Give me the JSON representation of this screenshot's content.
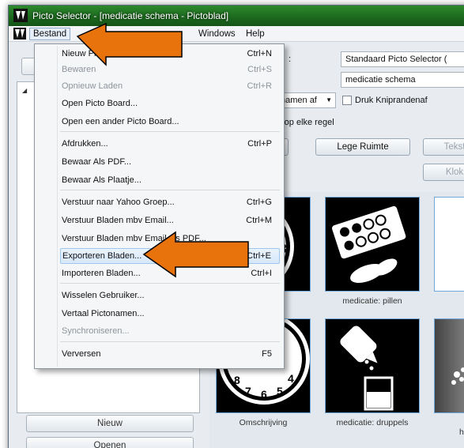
{
  "window": {
    "title": "Picto Selector - [medicatie schema - Pictoblad]"
  },
  "menubar": {
    "items": [
      {
        "label": "Bestand"
      },
      {
        "label": "Windows"
      },
      {
        "label": "Help"
      }
    ]
  },
  "toolbar": {
    "selector_label": "Standaard Picto Selector (",
    "document_name": "medicatie schema",
    "names_dropdown": "namen af",
    "print_cut_edges_label": "Druk Kniprandenaf",
    "per_row_text": "'s op elke regel",
    "btn_partial": "n",
    "lege_ruimte": "Lege Ruimte",
    "tekst": "Tekst",
    "klok": "Klok"
  },
  "left_panel": {
    "new_button": "Nieuw",
    "open_button": "Openen"
  },
  "grid": {
    "captions": {
      "row1_col1": "g",
      "row1_col2": "medicatie: pillen",
      "row2_col1": "Omschrijving",
      "row2_col2": "medicatie: druppels",
      "row2_col3_a": "me",
      "row2_col3_b": "homeop"
    },
    "clock_numbers": [
      "3",
      "8",
      "4",
      "7",
      "6",
      "5"
    ]
  },
  "file_menu": {
    "items": [
      {
        "label": "Nieuw Pictoblad",
        "shortcut": "Ctrl+N",
        "disabled": false
      },
      {
        "label": "Bewaren",
        "shortcut": "Ctrl+S",
        "disabled": true
      },
      {
        "label": "Opnieuw Laden",
        "shortcut": "Ctrl+R",
        "disabled": true
      },
      {
        "label": "Open Picto Board...",
        "shortcut": "",
        "disabled": false
      },
      {
        "label": "Open een ander Picto Board...",
        "shortcut": "",
        "disabled": false
      },
      {
        "label": "Afdrukken...",
        "shortcut": "Ctrl+P",
        "disabled": false
      },
      {
        "label": "Bewaar Als PDF...",
        "shortcut": "",
        "disabled": false
      },
      {
        "label": "Bewaar Als Plaatje...",
        "shortcut": "",
        "disabled": false
      },
      {
        "label": "Verstuur naar Yahoo Groep...",
        "shortcut": "Ctrl+G",
        "disabled": false
      },
      {
        "label": "Verstuur Bladen mbv Email...",
        "shortcut": "Ctrl+M",
        "disabled": false
      },
      {
        "label": "Verstuur Bladen mbv Email als PDF...",
        "shortcut": "",
        "disabled": false
      },
      {
        "label": "Exporteren Bladen...",
        "shortcut": "Ctrl+E",
        "disabled": false
      },
      {
        "label": "Importeren Bladen...",
        "shortcut": "Ctrl+I",
        "disabled": false
      },
      {
        "label": "Wisselen Gebruiker...",
        "shortcut": "",
        "disabled": false
      },
      {
        "label": "Vertaal Pictonamen...",
        "shortcut": "",
        "disabled": false
      },
      {
        "label": "Synchroniseren...",
        "shortcut": "",
        "disabled": true
      },
      {
        "label": "Verversen",
        "shortcut": "F5",
        "disabled": false
      }
    ]
  },
  "colors": {
    "arrow": "#e8720c",
    "titlebar": "#1d6a1f",
    "menu_hover": "#d6e8fa"
  }
}
